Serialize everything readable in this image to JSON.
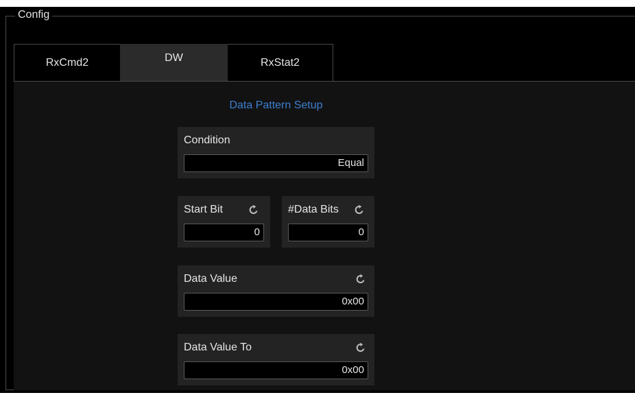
{
  "config": {
    "title": "Config"
  },
  "tabs": [
    {
      "label": "RxCmd2",
      "active": false
    },
    {
      "label": "DW",
      "active": true
    },
    {
      "label": "RxStat2",
      "active": false
    }
  ],
  "setup": {
    "title": "Data Pattern Setup",
    "condition": {
      "label": "Condition",
      "value": "Equal"
    },
    "start_bit": {
      "label": "Start Bit",
      "value": "0"
    },
    "data_bits": {
      "label": "#Data Bits",
      "value": "0"
    },
    "data_value": {
      "label": "Data Value",
      "value": "0x00"
    },
    "data_value_to": {
      "label": "Data Value To",
      "value": "0x00"
    }
  },
  "colors": {
    "accent": "#3d7fd1",
    "panel": "#232323",
    "active_tab": "#2b2b2b"
  },
  "icons": {
    "reset": "reset-icon"
  }
}
